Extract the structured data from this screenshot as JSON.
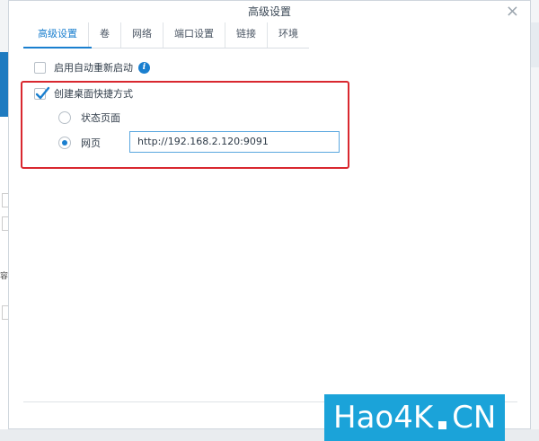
{
  "dialog": {
    "title": "高级设置",
    "close_label": "×"
  },
  "tabs": [
    {
      "label": "高级设置",
      "active": true
    },
    {
      "label": "卷",
      "active": false
    },
    {
      "label": "网络",
      "active": false
    },
    {
      "label": "端口设置",
      "active": false
    },
    {
      "label": "链接",
      "active": false
    },
    {
      "label": "环境",
      "active": false
    }
  ],
  "options": {
    "auto_restart": {
      "label": "启用自动重新启动",
      "checked": false
    },
    "desktop_shortcut": {
      "label": "创建桌面快捷方式",
      "checked": true
    },
    "status_page": {
      "label": "状态页面",
      "selected": false
    },
    "webpage": {
      "label": "网页",
      "selected": true,
      "url": "http://192.168.2.120:9091"
    }
  },
  "background": {
    "left_char": "容"
  },
  "watermark": {
    "text_left": "Hao4K",
    "text_right": "CN"
  },
  "colors": {
    "accent": "#1a7fcf",
    "highlight_border": "#d9282f",
    "watermark_bg": "#1ba3d9"
  }
}
